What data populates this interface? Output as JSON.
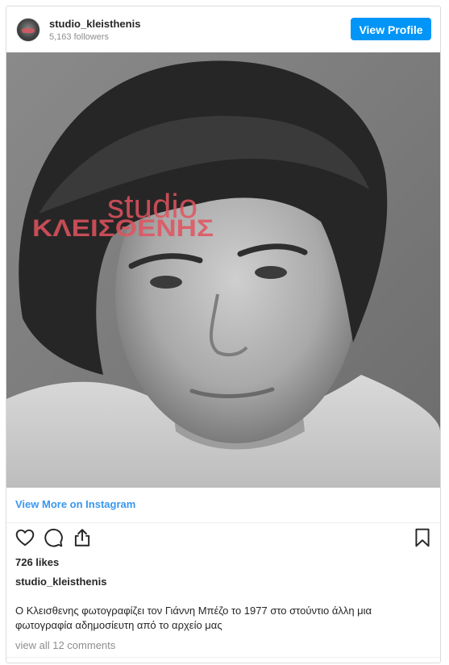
{
  "header": {
    "username": "studio_kleisthenis",
    "followers": "5,163 followers",
    "view_profile_label": "View Profile"
  },
  "photo": {
    "logo_line1": "studio",
    "logo_line2": "ΚΛΕΙΣΘΕΝΗΣ",
    "logo_color": "#e2535f"
  },
  "links": {
    "view_more": "View More on Instagram"
  },
  "actions": {
    "icons": [
      "heart-icon",
      "comment-icon",
      "share-icon",
      "bookmark-icon"
    ]
  },
  "post": {
    "likes": "726 likes",
    "caption_username": "studio_kleisthenis",
    "caption": "Ο Κλεισθενης φωτογραφίζει τον Γιάννη Μπέζο το 1977 στο στούντιο άλλη μια φωτογραφία αδημοσίευτη από το αρχείο μας",
    "comments_link": "view all 12 comments"
  },
  "colors": {
    "accent": "#0095f6",
    "link": "#3897f0",
    "muted": "#8e8e8e"
  }
}
